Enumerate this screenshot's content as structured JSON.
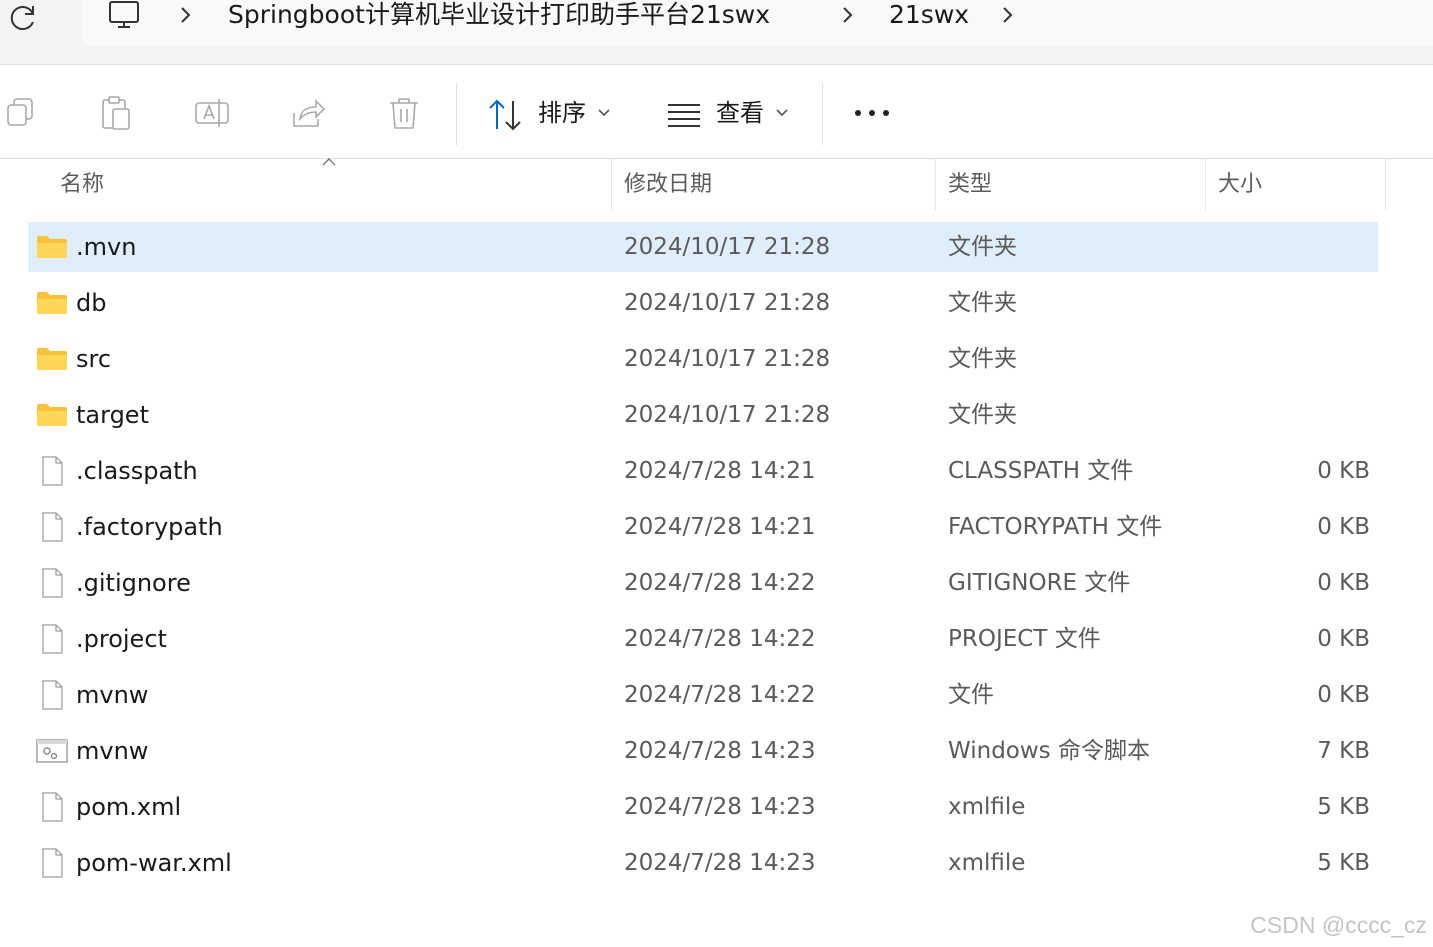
{
  "breadcrumb": {
    "items": [
      "Springboot计算机毕业设计打印助手平台21swx",
      "21swx"
    ]
  },
  "toolbar": {
    "sort_label": "排序",
    "view_label": "查看"
  },
  "columns": {
    "name": "名称",
    "date": "修改日期",
    "type": "类型",
    "size": "大小"
  },
  "colors": {
    "accent": "#0067c0",
    "selection": "#e0eefb",
    "folder": "#f8c33a"
  },
  "files": [
    {
      "name": ".mvn",
      "date": "2024/10/17 21:28",
      "type": "文件夹",
      "size": "",
      "icon": "folder-icon",
      "selected": true
    },
    {
      "name": "db",
      "date": "2024/10/17 21:28",
      "type": "文件夹",
      "size": "",
      "icon": "folder-icon"
    },
    {
      "name": "src",
      "date": "2024/10/17 21:28",
      "type": "文件夹",
      "size": "",
      "icon": "folder-icon"
    },
    {
      "name": "target",
      "date": "2024/10/17 21:28",
      "type": "文件夹",
      "size": "",
      "icon": "folder-icon"
    },
    {
      "name": ".classpath",
      "date": "2024/7/28 14:21",
      "type": "CLASSPATH 文件",
      "size": "0 KB",
      "icon": "file-icon"
    },
    {
      "name": ".factorypath",
      "date": "2024/7/28 14:21",
      "type": "FACTORYPATH 文件",
      "size": "0 KB",
      "icon": "file-icon"
    },
    {
      "name": ".gitignore",
      "date": "2024/7/28 14:22",
      "type": "GITIGNORE 文件",
      "size": "0 KB",
      "icon": "file-icon"
    },
    {
      "name": ".project",
      "date": "2024/7/28 14:22",
      "type": "PROJECT 文件",
      "size": "0 KB",
      "icon": "file-icon"
    },
    {
      "name": "mvnw",
      "date": "2024/7/28 14:22",
      "type": "文件",
      "size": "0 KB",
      "icon": "file-icon"
    },
    {
      "name": "mvnw",
      "date": "2024/7/28 14:23",
      "type": "Windows 命令脚本",
      "size": "7 KB",
      "icon": "script-icon"
    },
    {
      "name": "pom.xml",
      "date": "2024/7/28 14:23",
      "type": "xmlfile",
      "size": "5 KB",
      "icon": "file-icon"
    },
    {
      "name": "pom-war.xml",
      "date": "2024/7/28 14:23",
      "type": "xmlfile",
      "size": "5 KB",
      "icon": "file-icon"
    }
  ],
  "watermark": "CSDN @cccc_cz"
}
